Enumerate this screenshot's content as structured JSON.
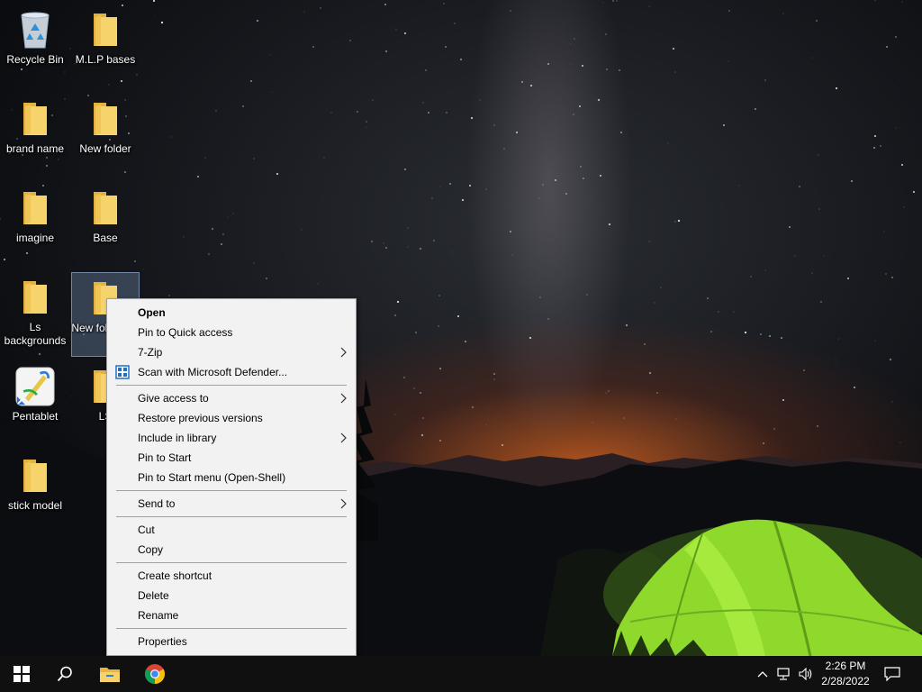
{
  "desktop": {
    "icons": [
      {
        "label": "Recycle Bin",
        "icon": "recycle-bin-icon"
      },
      {
        "label": "M.L.P bases",
        "icon": "folder-icon"
      },
      {
        "label": "brand name",
        "icon": "folder-icon"
      },
      {
        "label": "New folder",
        "icon": "folder-icon"
      },
      {
        "label": "imagine",
        "icon": "folder-icon"
      },
      {
        "label": "Base",
        "icon": "folder-icon"
      },
      {
        "label": "Ls backgrounds",
        "icon": "folder-icon"
      },
      {
        "label": "New folder (2)",
        "icon": "folder-icon",
        "selected": true
      },
      {
        "label": "Pentablet",
        "icon": "pentablet-icon"
      },
      {
        "label": "LS",
        "icon": "folder-icon"
      },
      {
        "label": "stick  model",
        "icon": "folder-icon"
      }
    ]
  },
  "context_menu": {
    "groups": [
      [
        {
          "label": "Open",
          "bold": true
        },
        {
          "label": "Pin to Quick access"
        },
        {
          "label": "7-Zip",
          "submenu": true
        },
        {
          "label": "Scan with Microsoft Defender...",
          "icon": "defender-shield-icon"
        }
      ],
      [
        {
          "label": "Give access to",
          "submenu": true
        },
        {
          "label": "Restore previous versions"
        },
        {
          "label": "Include in library",
          "submenu": true
        },
        {
          "label": "Pin to Start"
        },
        {
          "label": "Pin to Start menu (Open-Shell)"
        }
      ],
      [
        {
          "label": "Send to",
          "submenu": true
        }
      ],
      [
        {
          "label": "Cut"
        },
        {
          "label": "Copy"
        }
      ],
      [
        {
          "label": "Create shortcut"
        },
        {
          "label": "Delete"
        },
        {
          "label": "Rename"
        }
      ],
      [
        {
          "label": "Properties"
        }
      ]
    ]
  },
  "taskbar": {
    "buttons": [
      {
        "name": "start-button",
        "icon": "windows-logo-icon"
      },
      {
        "name": "search-button",
        "icon": "search-icon"
      },
      {
        "name": "file-explorer-button",
        "icon": "file-explorer-icon"
      },
      {
        "name": "chrome-button",
        "icon": "chrome-icon"
      }
    ],
    "tray": {
      "icons": [
        "chevron-up-icon",
        "network-icon",
        "volume-icon",
        "notification-icon"
      ]
    },
    "clock": {
      "time": "2:26 PM",
      "date": "2/28/2022"
    }
  },
  "colors": {
    "taskbar": "#101010",
    "menu_background": "#f2f2f2",
    "selection": "#7896be",
    "folder": "#f6d36b"
  }
}
